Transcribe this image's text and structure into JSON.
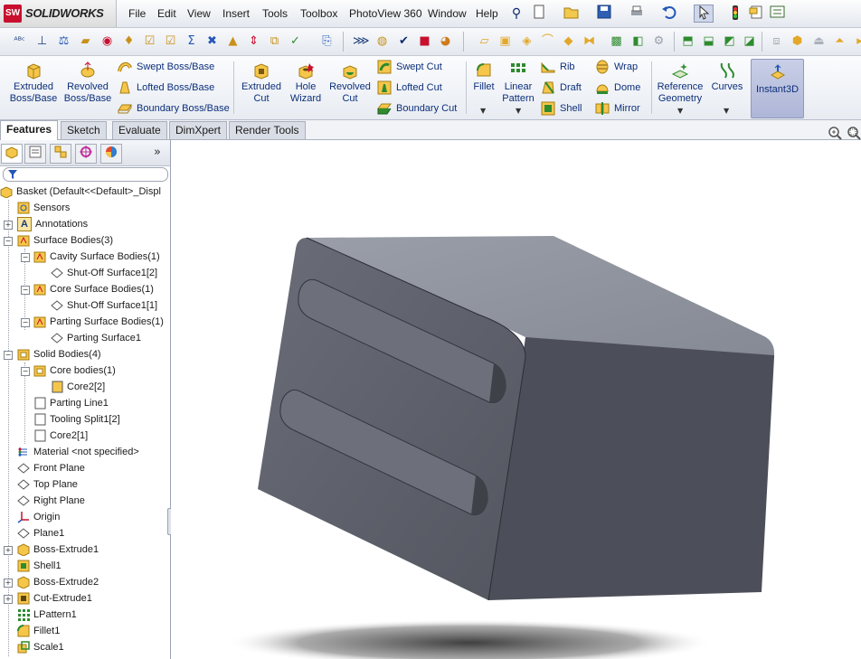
{
  "app": {
    "logo_badge": "SW",
    "logo_name": "SOLIDWORKS"
  },
  "menu": [
    "File",
    "Edit",
    "View",
    "Insert",
    "Tools",
    "Toolbox",
    "PhotoView 360",
    "Window",
    "Help"
  ],
  "command_manager": {
    "extruded_boss": "Extruded Boss/Base",
    "revolved_boss": "Revolved Boss/Base",
    "swept_boss": "Swept Boss/Base",
    "lofted_boss": "Lofted Boss/Base",
    "boundary_boss": "Boundary Boss/Base",
    "extruded_cut": "Extruded Cut",
    "hole_wizard": "Hole Wizard",
    "revolved_cut": "Revolved Cut",
    "swept_cut": "Swept Cut",
    "lofted_cut": "Lofted Cut",
    "boundary_cut": "Boundary Cut",
    "fillet": "Fillet",
    "linear_pattern": "Linear Pattern",
    "rib": "Rib",
    "draft": "Draft",
    "shell": "Shell",
    "wrap": "Wrap",
    "dome": "Dome",
    "mirror": "Mirror",
    "reference_geometry": "Reference Geometry",
    "curves": "Curves",
    "instant3d": "Instant3D"
  },
  "tabs": [
    "Features",
    "Sketch",
    "Evaluate",
    "DimXpert",
    "Render Tools"
  ],
  "tree": [
    {
      "label": "Basket  (Default<<Default>_Displ",
      "icon": "part-icon"
    },
    {
      "label": "Sensors",
      "icon": "sensors-icon"
    },
    {
      "label": "Annotations",
      "icon": "annotations-icon"
    },
    {
      "label": "Surface Bodies(3)",
      "icon": "surface-bodies-folder-icon"
    },
    {
      "label": "Cavity Surface Bodies(1)",
      "icon": "surface-bodies-folder-icon"
    },
    {
      "label": "Shut-Off Surface1[2]",
      "icon": "surface-icon"
    },
    {
      "label": "Core Surface Bodies(1)",
      "icon": "surface-bodies-folder-icon"
    },
    {
      "label": "Shut-Off Surface1[1]",
      "icon": "surface-icon"
    },
    {
      "label": "Parting Surface Bodies(1)",
      "icon": "surface-bodies-folder-icon"
    },
    {
      "label": "Parting Surface1",
      "icon": "surface-icon"
    },
    {
      "label": "Solid Bodies(4)",
      "icon": "solid-bodies-folder-icon"
    },
    {
      "label": "Core bodies(1)",
      "icon": "solid-bodies-folder-icon"
    },
    {
      "label": "Core2[2]",
      "icon": "solid-body-icon"
    },
    {
      "label": "Parting Line1",
      "icon": "solid-body-icon"
    },
    {
      "label": "Tooling Split1[2]",
      "icon": "solid-body-icon"
    },
    {
      "label": "Core2[1]",
      "icon": "solid-body-icon"
    },
    {
      "label": "Material <not specified>",
      "icon": "material-icon"
    },
    {
      "label": "Front Plane",
      "icon": "plane-icon"
    },
    {
      "label": "Top Plane",
      "icon": "plane-icon"
    },
    {
      "label": "Right Plane",
      "icon": "plane-icon"
    },
    {
      "label": "Origin",
      "icon": "origin-icon"
    },
    {
      "label": "Plane1",
      "icon": "plane-icon"
    },
    {
      "label": "Boss-Extrude1",
      "icon": "extrude-icon"
    },
    {
      "label": "Shell1",
      "icon": "shell-icon"
    },
    {
      "label": "Boss-Extrude2",
      "icon": "extrude-icon"
    },
    {
      "label": "Cut-Extrude1",
      "icon": "cut-extrude-icon"
    },
    {
      "label": "LPattern1",
      "icon": "linear-pattern-icon"
    },
    {
      "label": "Fillet1",
      "icon": "fillet-icon"
    },
    {
      "label": "Scale1",
      "icon": "scale-icon"
    }
  ],
  "colors": {
    "accent": "#0c2f7a",
    "model_front": "#5b5e69",
    "model_top": "#8d919c",
    "model_side": "#4c4f59",
    "instant3d_active": "#b3bbdc"
  }
}
